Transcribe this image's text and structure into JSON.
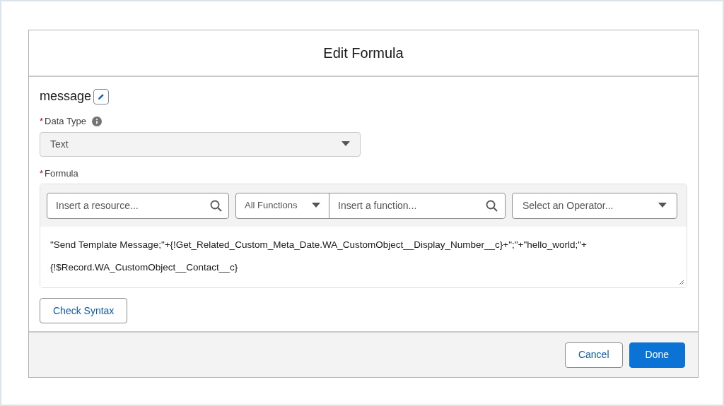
{
  "dialog": {
    "title": "Edit Formula"
  },
  "resource": {
    "name": "message"
  },
  "data_type": {
    "required_mark": "*",
    "label": "Data Type",
    "value": "Text"
  },
  "formula": {
    "required_mark": "*",
    "label": "Formula",
    "resource_search": {
      "placeholder": "Insert a resource..."
    },
    "function_category": {
      "value": "All Functions"
    },
    "function_search": {
      "placeholder": "Insert a function..."
    },
    "operator_select": {
      "placeholder": "Select an Operator..."
    },
    "lines": [
      "\"Send Template Message;\"+{!Get_Related_Custom_Meta_Date.WA_CustomObject__Display_Number__c}+\";\"+\"hello_world;\"+",
      "{!$Record.WA_CustomObject__Contact__c}"
    ]
  },
  "check_syntax_button": "Check Syntax",
  "footer_buttons": [
    {
      "label": "Cancel",
      "kind": "neutral"
    },
    {
      "label": "Done",
      "kind": "brand"
    }
  ]
}
